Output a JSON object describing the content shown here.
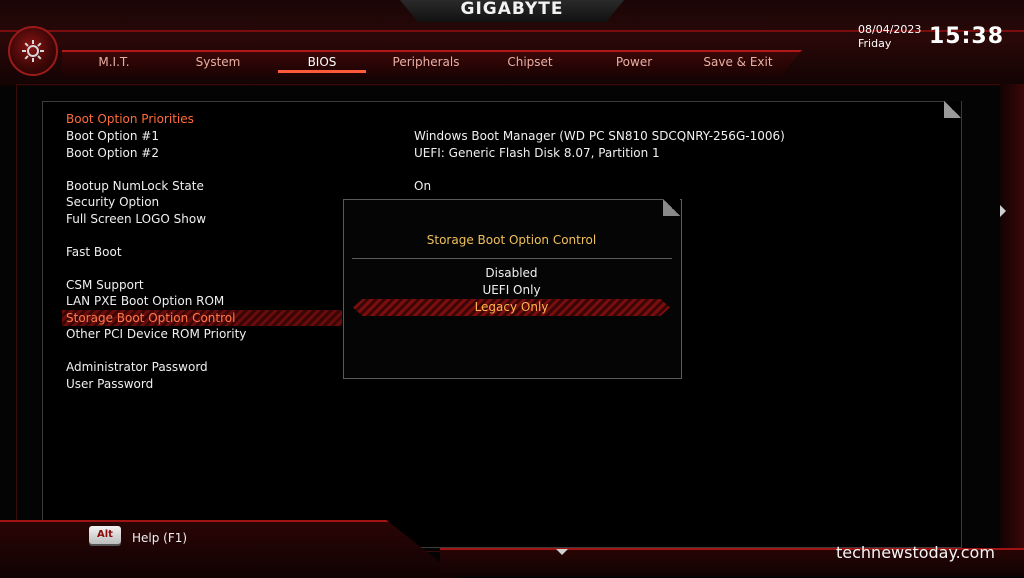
{
  "header": {
    "brand": "GIGABYTE",
    "date": "08/04/2023",
    "day": "Friday",
    "time": "15:38",
    "tabs": [
      {
        "label": "M.I.T.",
        "active": false
      },
      {
        "label": "System",
        "active": false
      },
      {
        "label": "BIOS",
        "active": true
      },
      {
        "label": "Peripherals",
        "active": false
      },
      {
        "label": "Chipset",
        "active": false
      },
      {
        "label": "Power",
        "active": false
      },
      {
        "label": "Save & Exit",
        "active": false
      }
    ]
  },
  "settings": {
    "section_title": "Boot Option Priorities",
    "boot1": {
      "label": "Boot Option #1",
      "value": "Windows Boot Manager (WD PC SN810 SDCQNRY-256G-1006)"
    },
    "boot2": {
      "label": "Boot Option #2",
      "value": "UEFI: Generic Flash Disk 8.07, Partition 1"
    },
    "numlock": {
      "label": "Bootup NumLock State",
      "value": "On"
    },
    "security": {
      "label": "Security Option"
    },
    "logo": {
      "label": "Full Screen LOGO Show"
    },
    "fastboot": {
      "label": "Fast Boot"
    },
    "csm": {
      "label": "CSM Support"
    },
    "lanpxe": {
      "label": "LAN PXE Boot Option ROM"
    },
    "storage": {
      "label": "Storage Boot Option Control"
    },
    "otherpci": {
      "label": "Other PCI Device ROM Priority"
    },
    "adminpw": {
      "label": "Administrator Password"
    },
    "userpw": {
      "label": "User Password"
    }
  },
  "popup": {
    "title": "Storage Boot Option Control",
    "options": [
      "Disabled",
      "UEFI Only",
      "Legacy Only"
    ],
    "selected": "Legacy Only"
  },
  "footer": {
    "alt_key": "Alt",
    "help_label": "Help (F1)"
  },
  "watermark": "technewstoday.com",
  "colors": {
    "accent_red": "#b01818",
    "highlight_orange": "#ff7a4a",
    "popup_title": "#f0c05a",
    "selected_option": "#ffb64a"
  }
}
